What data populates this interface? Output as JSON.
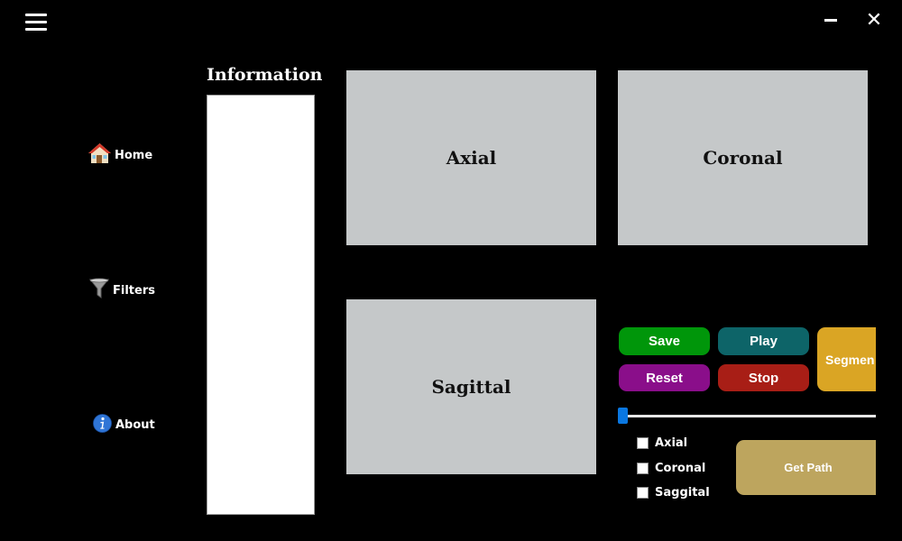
{
  "nav": {
    "home_label": "Home",
    "filters_label": "Filters",
    "about_label": "About"
  },
  "info": {
    "title": "Information"
  },
  "views": {
    "axial": "Axial",
    "coronal": "Coronal",
    "sagittal": "Sagittal"
  },
  "buttons": {
    "save": "Save",
    "play": "Play",
    "reset": "Reset",
    "stop": "Stop",
    "segment": "Segmen",
    "get_path": "Get Path"
  },
  "checkboxes": [
    {
      "label": "Axial",
      "checked": false
    },
    {
      "label": "Coronal",
      "checked": false
    },
    {
      "label": "Saggital",
      "checked": false
    }
  ],
  "slider": {
    "value": 0
  },
  "colors": {
    "save": "#00960a",
    "play": "#0d6468",
    "reset": "#8a0e8a",
    "stop": "#a81e16",
    "segment": "#daa524",
    "get_path": "#bda55e",
    "view_bg": "#c5c8c9",
    "slider_thumb": "#0a77e0"
  },
  "icons": {
    "menu": "hamburger-icon",
    "minimize": "minimize-icon",
    "close": "close-icon",
    "home": "house-icon",
    "filters": "funnel-icon",
    "about": "info-icon"
  }
}
